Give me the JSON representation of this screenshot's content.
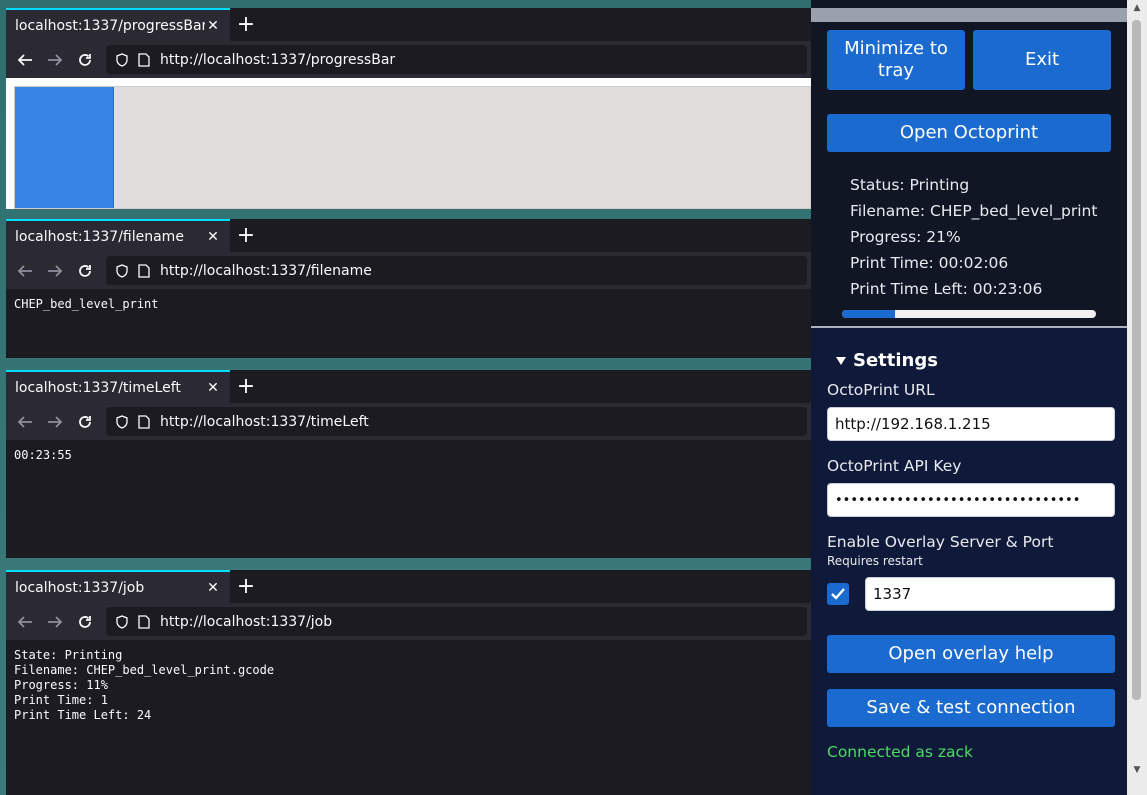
{
  "windows": [
    {
      "tab_title": "localhost:1337/progressBar",
      "url": "http://localhost:1337/progressBar"
    },
    {
      "tab_title": "localhost:1337/filename",
      "url": "http://localhost:1337/filename",
      "content": "CHEP_bed_level_print"
    },
    {
      "tab_title": "localhost:1337/timeLeft",
      "url": "http://localhost:1337/timeLeft",
      "content": "00:23:55"
    },
    {
      "tab_title": "localhost:1337/job",
      "url": "http://localhost:1337/job",
      "content": "State: Printing\nFilename: CHEP_bed_level_print.gcode\nProgress: 11%\nPrint Time: 1\nPrint Time Left: 24"
    }
  ],
  "progress_bar_page": {
    "fill_fraction": 0.125
  },
  "panel": {
    "minimize_label": "Minimize to tray",
    "exit_label": "Exit",
    "open_octoprint_label": "Open Octoprint",
    "status_lines": [
      "Status: Printing",
      "Filename: CHEP_bed_level_print",
      "Progress: 21%",
      "Print Time: 00:02:06",
      "Print Time Left: 00:23:06"
    ],
    "progress_fraction": 0.21,
    "settings_heading": "Settings",
    "url_label": "OctoPrint URL",
    "url_value": "http://192.168.1.215",
    "api_label": "OctoPrint API Key",
    "api_value": "••••••••••••••••••••••••••••••••",
    "overlay_label": "Enable Overlay Server & Port",
    "overlay_sub": "Requires restart",
    "overlay_enabled": true,
    "port_value": "1337",
    "overlay_help_label": "Open overlay help",
    "save_label": "Save & test connection",
    "connection_status": "Connected as zack"
  },
  "icons": [
    "back-arrow-icon",
    "forward-arrow-icon",
    "reload-icon",
    "shield-icon",
    "page-icon",
    "close-icon",
    "plus-icon",
    "checkmark-icon",
    "triangle-down-icon"
  ],
  "colors": {
    "accent": "#1a6ad0",
    "success": "#4cd964",
    "tab_highlight": "#00ddff"
  }
}
